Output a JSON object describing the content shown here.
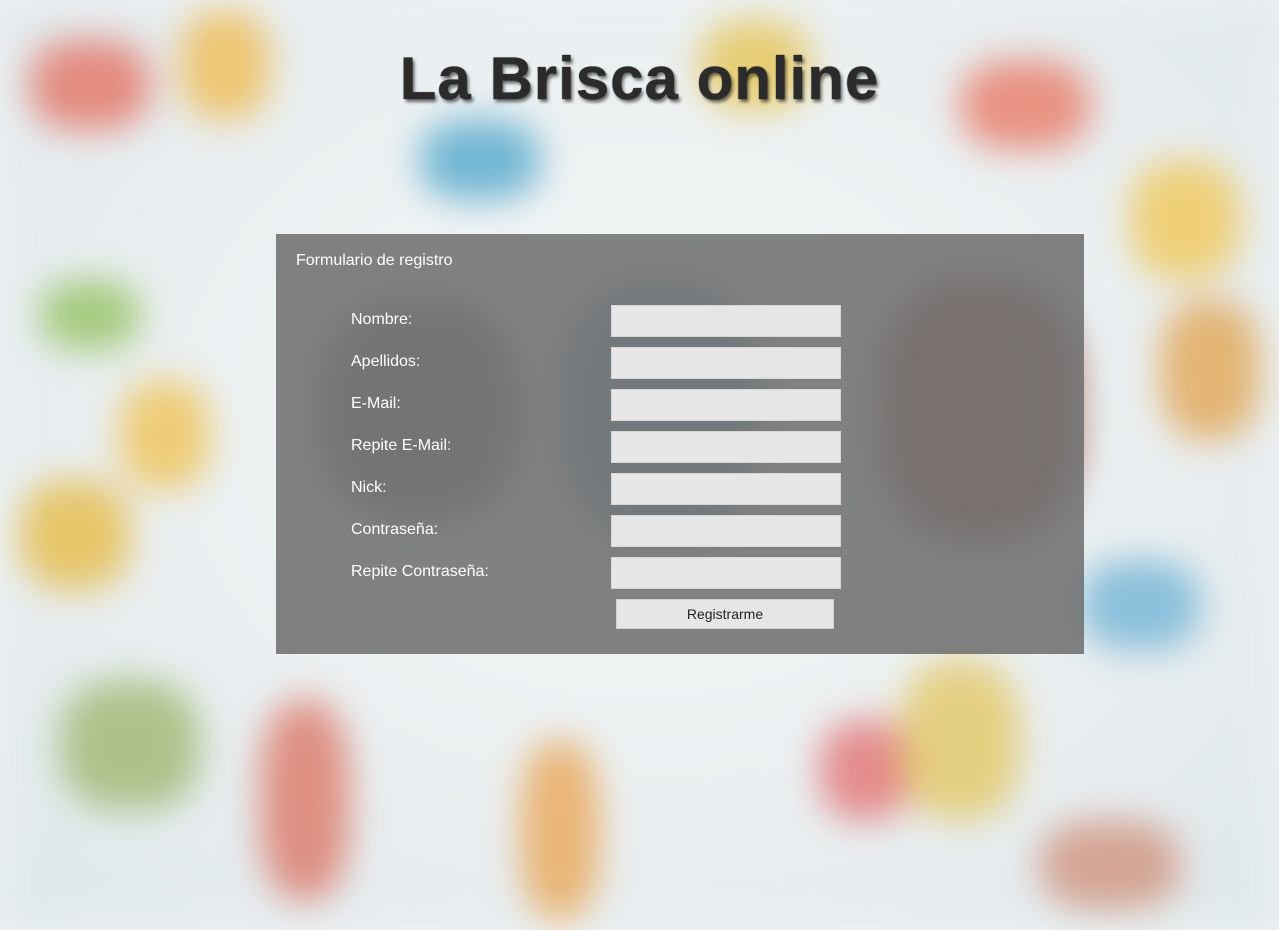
{
  "header": {
    "title": "La Brisca online"
  },
  "form": {
    "heading": "Formulario de registro",
    "fields": [
      {
        "label": "Nombre:",
        "value": ""
      },
      {
        "label": "Apellidos:",
        "value": ""
      },
      {
        "label": "E-Mail:",
        "value": ""
      },
      {
        "label": "Repite E-Mail:",
        "value": ""
      },
      {
        "label": "Nick:",
        "value": ""
      },
      {
        "label": "Contraseña:",
        "value": ""
      },
      {
        "label": "Repite Contraseña:",
        "value": ""
      }
    ],
    "submit_label": "Registrarme"
  },
  "colors": {
    "panel_background": "#6e6e6e",
    "input_background": "#e6e6e6",
    "title_text": "#2b2b2b"
  }
}
